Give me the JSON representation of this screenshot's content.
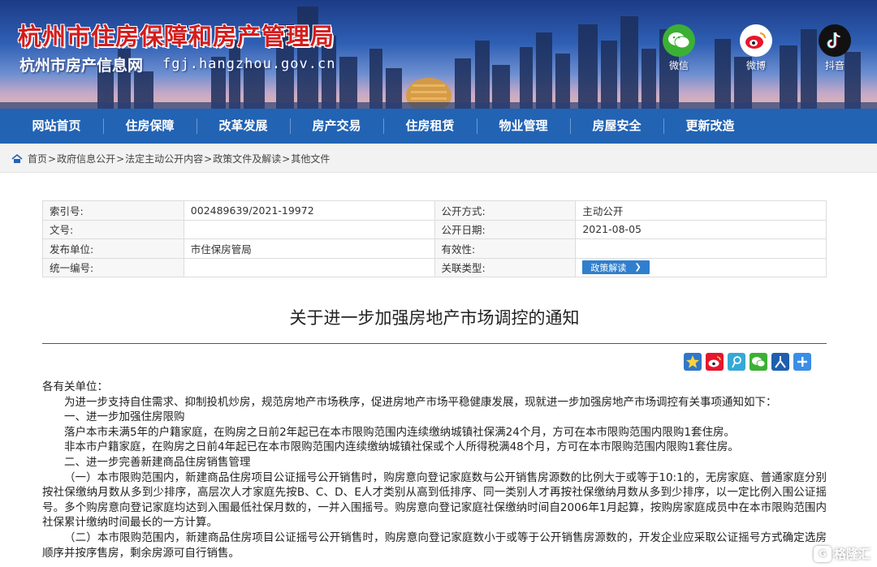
{
  "banner": {
    "title": "杭州市住房保障和房产管理局",
    "subtitle": "杭州市房产信息网",
    "domain": "fgj.hangzhou.gov.cn",
    "social": [
      {
        "label": "微信",
        "icon": "wechat-icon",
        "color": "#3cb034"
      },
      {
        "label": "微博",
        "icon": "weibo-icon",
        "color": "#e6162d"
      },
      {
        "label": "抖音",
        "icon": "douyin-icon",
        "color": "#111111"
      }
    ]
  },
  "nav": {
    "items": [
      "网站首页",
      "住房保障",
      "改革发展",
      "房产交易",
      "住房租赁",
      "物业管理",
      "房屋安全",
      "更新改造"
    ]
  },
  "breadcrumb": {
    "items": [
      "首页",
      "政府信息公开",
      "法定主动公开内容",
      "政策文件及解读",
      "其他文件"
    ],
    "separator": ">"
  },
  "info": {
    "index_label": "索引号:",
    "index_value": "002489639/2021-19972",
    "method_label": "公开方式:",
    "method_value": "主动公开",
    "docno_label": "文号:",
    "docno_value": "",
    "date_label": "公开日期:",
    "date_value": "2021-08-05",
    "issuer_label": "发布单位:",
    "issuer_value": "市住保房管局",
    "validity_label": "有效性:",
    "validity_value": "",
    "code_label": "统一编号:",
    "code_value": "",
    "related_label": "关联类型:",
    "related_button": "政策解读"
  },
  "document": {
    "title": "关于进一步加强房地产市场调控的通知",
    "salutation": "各有关单位：",
    "paragraphs": [
      "为进一步支持自住需求、抑制投机炒房，规范房地产市场秩序，促进房地产市场平稳健康发展，现就进一步加强房地产市场调控有关事项通知如下：",
      "一、进一步加强住房限购",
      "落户本市未满5年的户籍家庭，在购房之日前2年起已在本市限购范围内连续缴纳城镇社保满24个月，方可在本市限购范围内限购1套住房。",
      "非本市户籍家庭，在购房之日前4年起已在本市限购范围内连续缴纳城镇社保或个人所得税满48个月，方可在本市限购范围内限购1套住房。",
      "二、进一步完善新建商品住房销售管理",
      "（一）本市限购范围内，新建商品住房项目公证摇号公开销售时，购房意向登记家庭数与公开销售房源数的比例大于或等于10:1的，无房家庭、普通家庭分别按社保缴纳月数从多到少排序，高层次人才家庭先按B、C、D、E人才类别从高到低排序、同一类别人才再按社保缴纳月数从多到少排序，以一定比例入围公证摇号。多个购房意向登记家庭均达到入围最低社保月数的，一并入围摇号。购房意向登记家庭社保缴纳时间自2006年1月起算，按购房家庭成员中在本市限购范围内社保累计缴纳时间最长的一方计算。",
      "（二）本市限购范围内，新建商品住房项目公证摇号公开销售时，购房意向登记家庭数小于或等于公开销售房源数的，开发企业应采取公证摇号方式确定选房顺序并按序售房，剩余房源可自行销售。"
    ]
  },
  "share": [
    "qzone-icon",
    "weibo-icon",
    "tencent-weibo-icon",
    "wechat-icon",
    "renren-icon",
    "more-share-icon"
  ],
  "watermark": "格隆汇",
  "colors": {
    "nav_bg": "#2263b4",
    "title_red": "#d41d1d",
    "button_blue": "#2f7fce"
  }
}
